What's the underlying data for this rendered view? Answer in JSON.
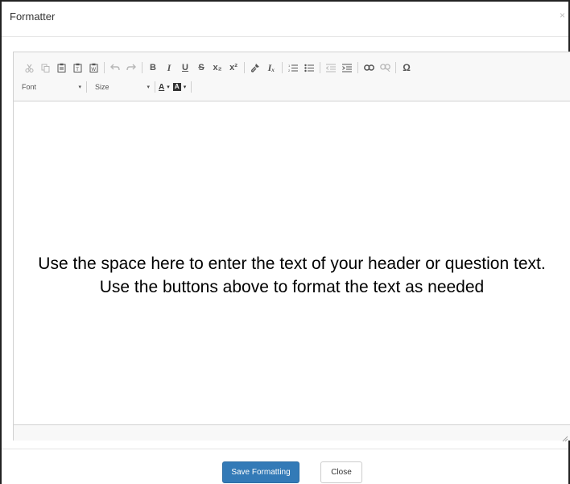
{
  "modal": {
    "title": "Formatter",
    "close_symbol": "×"
  },
  "toolbar": {
    "row1": [
      {
        "name": "cut-icon",
        "glyph": "✂",
        "disabled": true
      },
      {
        "name": "copy-icon",
        "glyph": "⎘",
        "disabled": true
      },
      {
        "name": "paste-icon",
        "glyph": "📋",
        "disabled": false
      },
      {
        "name": "paste-text-icon",
        "glyph": "📋",
        "disabled": false
      },
      {
        "name": "paste-word-icon",
        "glyph": "📋",
        "disabled": false
      },
      {
        "name": "undo-icon",
        "glyph": "↶",
        "disabled": true
      },
      {
        "name": "redo-icon",
        "glyph": "↷",
        "disabled": true
      },
      {
        "name": "bold-button",
        "glyph": "B"
      },
      {
        "name": "italic-button",
        "glyph": "I"
      },
      {
        "name": "underline-button",
        "glyph": "U"
      },
      {
        "name": "strike-button",
        "glyph": "S"
      },
      {
        "name": "subscript-button",
        "glyph": "x₂"
      },
      {
        "name": "superscript-button",
        "glyph": "x²"
      },
      {
        "name": "copy-format-icon",
        "glyph": "🖌"
      },
      {
        "name": "remove-format-button",
        "glyph": "Iₓ"
      },
      {
        "name": "numbered-list-icon",
        "glyph": "≡"
      },
      {
        "name": "bulleted-list-icon",
        "glyph": "≡"
      },
      {
        "name": "outdent-icon",
        "glyph": "⇤",
        "disabled": true
      },
      {
        "name": "indent-icon",
        "glyph": "⇥"
      },
      {
        "name": "link-icon",
        "glyph": "∞"
      },
      {
        "name": "unlink-icon",
        "glyph": "∞",
        "disabled": true
      },
      {
        "name": "special-char-button",
        "glyph": "Ω"
      }
    ],
    "font_label": "Font",
    "size_label": "Size",
    "text_color_letter": "A",
    "bg_color_letter": "A",
    "dropdown_arrow": "▾"
  },
  "editor": {
    "content": "Use the space here to enter the text of your header or question text. Use the buttons above to format the text as needed"
  },
  "footer": {
    "save_label": "Save Formatting",
    "close_label": "Close"
  },
  "colors": {
    "primary": "#337ab7",
    "toolbar_bg": "#f8f8f8",
    "border": "#d1d1d1"
  }
}
